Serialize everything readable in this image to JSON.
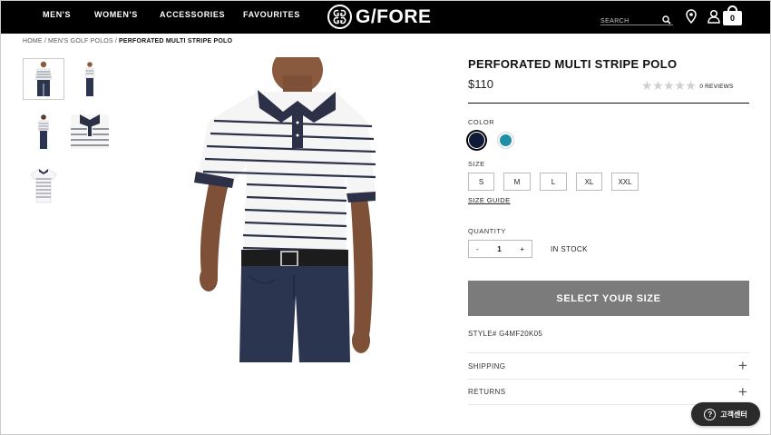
{
  "header": {
    "nav": [
      {
        "label": "MEN'S"
      },
      {
        "label": "WOMEN'S"
      },
      {
        "label": "ACCESSORIES"
      },
      {
        "label": "FAVOURITES"
      }
    ],
    "logo_text": "G/FORE",
    "search_placeholder": "SEARCH",
    "cart_count": "0",
    "icons": [
      "search-icon",
      "location-pin-icon",
      "user-icon",
      "shopping-bag-icon"
    ]
  },
  "breadcrumb": {
    "items": [
      "HOME",
      "MEN'S GOLF POLOS",
      "PERFORATED MULTI STRIPE POLO"
    ],
    "separator": "/"
  },
  "product": {
    "title": "PERFORATED MULTI STRIPE POLO",
    "price": "$110",
    "rating": {
      "stars": 0,
      "max": 5,
      "reviews_label": "0 REVIEWS"
    },
    "color_label": "COLOR",
    "colors": [
      {
        "name": "navy",
        "hex": "#0f1a36",
        "selected": true
      },
      {
        "name": "teal",
        "hex": "#1f8fa6",
        "selected": false
      }
    ],
    "size_label": "SIZE",
    "sizes": [
      "S",
      "M",
      "L",
      "XL",
      "XXL"
    ],
    "size_guide_label": "SIZE GUIDE",
    "quantity_label": "QUANTITY",
    "quantity": {
      "minus": "-",
      "value": "1",
      "plus": "+"
    },
    "stock_status": "IN STOCK",
    "cta_label": "SELECT YOUR SIZE",
    "style_number": "STYLE# G4MF20K05",
    "accordions": [
      {
        "label": "SHIPPING",
        "icon": "+"
      },
      {
        "label": "RETURNS",
        "icon": "+"
      }
    ]
  },
  "help_widget": {
    "label": "고객센터",
    "icon": "?"
  },
  "colors": {
    "header_bg": "#000000",
    "cta_bg": "#7b7b7b",
    "shirt_stripe": "#2d3147",
    "pants": "#2c3550"
  }
}
